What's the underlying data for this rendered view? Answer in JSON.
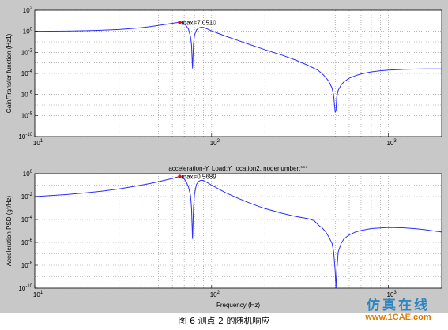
{
  "caption": "图 6 测点 2 的随机响应",
  "watermark": {
    "top_text": "仿真在线",
    "bottom_text": "www.1CAE.com"
  },
  "colors": {
    "curve": "#2b2bff",
    "marker": "#ff0000",
    "figure_bg": "#c8c8c8",
    "axes_bg": "#ffffff"
  },
  "chart_data": [
    {
      "type": "line",
      "title": "",
      "xlabel": "",
      "ylabel": "Gain/Transfer function (Hz1)",
      "xscale": "log",
      "yscale": "log",
      "xlim": [
        10,
        2000
      ],
      "ylim": [
        1e-10,
        100
      ],
      "grid": "minor dotted",
      "yticks": [
        {
          "value": 100,
          "label": "10",
          "exp": "2"
        },
        {
          "value": 1,
          "label": "10",
          "exp": "0"
        },
        {
          "value": 0.01,
          "label": "10",
          "exp": "-2"
        },
        {
          "value": 0.0001,
          "label": "10",
          "exp": "-4"
        },
        {
          "value": 1e-06,
          "label": "10",
          "exp": "-6"
        },
        {
          "value": 1e-08,
          "label": "10",
          "exp": "-8"
        },
        {
          "value": 1e-10,
          "label": "10",
          "exp": "-10"
        }
      ],
      "xticks": [
        {
          "value": 10,
          "label": "10",
          "exp": "1"
        },
        {
          "value": 100,
          "label": "10",
          "exp": "2"
        },
        {
          "value": 1000,
          "label": "10",
          "exp": "3"
        }
      ],
      "series": [
        {
          "x": [
            10,
            15,
            20,
            25,
            30,
            35,
            40,
            45,
            50,
            55,
            60,
            63,
            66,
            68,
            70,
            72,
            74,
            76,
            77,
            78,
            79,
            80,
            82,
            84,
            86,
            88,
            90,
            92,
            95,
            100,
            110,
            120,
            140,
            160,
            180,
            200,
            250,
            300,
            350,
            400,
            430,
            460,
            480,
            490,
            500,
            505,
            510,
            520,
            540,
            560,
            600,
            650,
            700,
            800,
            900,
            1000,
            1200,
            1400,
            1600,
            1800,
            2000
          ],
          "y": [
            1,
            1.05,
            1.15,
            1.3,
            1.5,
            1.8,
            2.2,
            2.8,
            3.6,
            4.6,
            5.8,
            6.6,
            7.05,
            6.8,
            5.2,
            3.2,
            1.6,
            0.3,
            0.05,
            0.0003,
            0.06,
            0.4,
            1.3,
            1.9,
            2.3,
            2.4,
            2.3,
            2.0,
            1.6,
            1.1,
            0.6,
            0.35,
            0.14,
            0.065,
            0.033,
            0.018,
            0.0055,
            0.0018,
            0.0006,
            0.0002,
            7e-05,
            1.8e-05,
            4e-06,
            8e-07,
            2e-08,
            3e-08,
            6e-07,
            2.5e-06,
            8e-06,
            1.6e-05,
            3.5e-05,
            6e-05,
            9e-05,
            0.00014,
            0.00018,
            0.00021,
            0.00024,
            0.00026,
            0.00027,
            0.00027,
            0.00027
          ]
        }
      ],
      "peak": {
        "x": 66,
        "y": 7.05,
        "text": "max=7.0510"
      }
    },
    {
      "type": "line",
      "title": "acceleration-Y, Load:Y, location2, nodenumber:***",
      "xlabel": "Frequency (Hz)",
      "ylabel": "Acceleration PSD (g²/Hz)",
      "xscale": "log",
      "yscale": "log",
      "xlim": [
        10,
        2000
      ],
      "ylim": [
        1e-10,
        1
      ],
      "grid": "minor dotted",
      "yticks": [
        {
          "value": 1,
          "label": "10",
          "exp": "0"
        },
        {
          "value": 0.01,
          "label": "10",
          "exp": "-2"
        },
        {
          "value": 0.0001,
          "label": "10",
          "exp": "-4"
        },
        {
          "value": 1e-06,
          "label": "10",
          "exp": "-6"
        },
        {
          "value": 1e-08,
          "label": "10",
          "exp": "-8"
        },
        {
          "value": 1e-10,
          "label": "10",
          "exp": "-10"
        }
      ],
      "xticks": [
        {
          "value": 10,
          "label": "10",
          "exp": "1"
        },
        {
          "value": 100,
          "label": "10",
          "exp": "2"
        },
        {
          "value": 1000,
          "label": "10",
          "exp": "3"
        }
      ],
      "series": [
        {
          "x": [
            10,
            15,
            20,
            25,
            30,
            35,
            40,
            45,
            50,
            55,
            60,
            63,
            66,
            68,
            70,
            72,
            74,
            76,
            77,
            78,
            79,
            80,
            82,
            84,
            86,
            88,
            90,
            92,
            95,
            100,
            110,
            120,
            140,
            160,
            180,
            200,
            250,
            300,
            350,
            380,
            400,
            410,
            420,
            440,
            460,
            480,
            490,
            500,
            505,
            510,
            520,
            540,
            560,
            600,
            650,
            700,
            800,
            900,
            1000,
            1200,
            1400,
            1600,
            1800,
            2000
          ],
          "y": [
            0.01,
            0.015,
            0.022,
            0.032,
            0.047,
            0.07,
            0.1,
            0.14,
            0.2,
            0.28,
            0.38,
            0.48,
            0.5689,
            0.52,
            0.35,
            0.18,
            0.07,
            0.012,
            0.001,
            2e-06,
            0.001,
            0.015,
            0.11,
            0.2,
            0.25,
            0.27,
            0.25,
            0.21,
            0.16,
            0.1,
            0.045,
            0.022,
            0.0075,
            0.0032,
            0.0016,
            0.0009,
            0.00035,
            0.00018,
            0.00012,
            8e-05,
            3.5e-05,
            2.5e-05,
            2e-05,
            9e-06,
            3e-06,
            8e-07,
            1.5e-07,
            3e-09,
            1e-10,
            3e-09,
            1.5e-07,
            8e-07,
            2e-06,
            4.5e-06,
            8e-06,
            1.1e-05,
            1.6e-05,
            1.8e-05,
            2e-05,
            1.9e-05,
            1.6e-05,
            1.3e-05,
            1e-05,
            8e-06
          ]
        }
      ],
      "peak": {
        "x": 66,
        "y": 0.5689,
        "text": "max=0.5689"
      }
    }
  ]
}
